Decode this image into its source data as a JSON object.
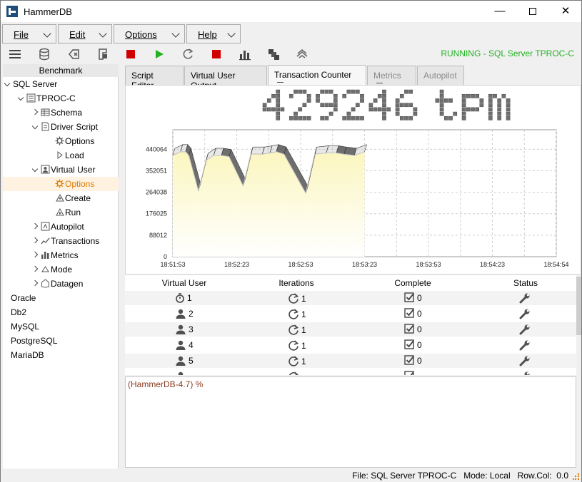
{
  "window": {
    "title": "HammerDB"
  },
  "menu": [
    {
      "label": "File"
    },
    {
      "label": "Edit"
    },
    {
      "label": "Options"
    },
    {
      "label": "Help"
    }
  ],
  "toolbar": {
    "status": "RUNNING - SQL Server TPROC-C"
  },
  "tree": {
    "header": "Benchmark",
    "nodes": [
      {
        "label": "SQL Server"
      },
      {
        "label": "TPROC-C"
      },
      {
        "label": "Schema"
      },
      {
        "label": "Driver Script"
      },
      {
        "label": "Options"
      },
      {
        "label": "Load"
      },
      {
        "label": "Virtual User"
      },
      {
        "label": "Options"
      },
      {
        "label": "Create"
      },
      {
        "label": "Run"
      },
      {
        "label": "Autopilot"
      },
      {
        "label": "Transactions"
      },
      {
        "label": "Metrics"
      },
      {
        "label": "Mode"
      },
      {
        "label": "Datagen"
      },
      {
        "label": "Oracle"
      },
      {
        "label": "Db2"
      },
      {
        "label": "MySQL"
      },
      {
        "label": "PostgreSQL"
      },
      {
        "label": "MariaDB"
      }
    ]
  },
  "tabs": [
    {
      "label": "Script Editor"
    },
    {
      "label": "Virtual User Output"
    },
    {
      "label": "Transaction Counter"
    },
    {
      "label": "Metrics"
    },
    {
      "label": "Autopilot"
    }
  ],
  "counter": {
    "value": "429246",
    "unit": "tpm"
  },
  "chart_data": {
    "type": "area",
    "x": [
      "18:51:53",
      "18:52:23",
      "18:52:53",
      "18:53:23",
      "18:53:53",
      "18:54:23",
      "18:54:54"
    ],
    "y_ticks": [
      "0",
      "88012",
      "176025",
      "264038",
      "352051",
      "440064"
    ],
    "ylim": [
      0,
      520000
    ],
    "points": [
      [
        0,
        415000
      ],
      [
        0.12,
        430000
      ],
      [
        0.2,
        430000
      ],
      [
        0.25,
        415000
      ],
      [
        0.4,
        270000
      ],
      [
        0.52,
        395000
      ],
      [
        0.64,
        415000
      ],
      [
        0.76,
        415000
      ],
      [
        0.88,
        410000
      ],
      [
        1.1,
        290000
      ],
      [
        1.22,
        420000
      ],
      [
        1.4,
        420000
      ],
      [
        1.52,
        425000
      ],
      [
        1.62,
        430000
      ],
      [
        1.74,
        420000
      ],
      [
        2.08,
        260000
      ],
      [
        2.22,
        420000
      ],
      [
        2.4,
        425000
      ],
      [
        2.56,
        425000
      ],
      [
        2.68,
        420000
      ],
      [
        2.84,
        415000
      ],
      [
        3.0,
        430000
      ]
    ],
    "grid": true,
    "fill_color": "#fbf6bf",
    "line_color": "#c8c8c8"
  },
  "grid": {
    "headers": [
      "Virtual User",
      "Iterations",
      "Complete",
      "Status"
    ],
    "rows": [
      {
        "user": "1",
        "iter": "1",
        "complete": "0",
        "icon": "timer-icon"
      },
      {
        "user": "2",
        "iter": "1",
        "complete": "0",
        "icon": "user-icon"
      },
      {
        "user": "3",
        "iter": "1",
        "complete": "0",
        "icon": "user-icon"
      },
      {
        "user": "4",
        "iter": "1",
        "complete": "0",
        "icon": "user-icon"
      },
      {
        "user": "5",
        "iter": "1",
        "complete": "0",
        "icon": "user-icon"
      }
    ]
  },
  "console": {
    "prompt": "(HammerDB-4.7) %"
  },
  "statusbar": {
    "text": "File: SQL Server TPROC-C   Mode: Local   Row.Col:  0.0"
  }
}
